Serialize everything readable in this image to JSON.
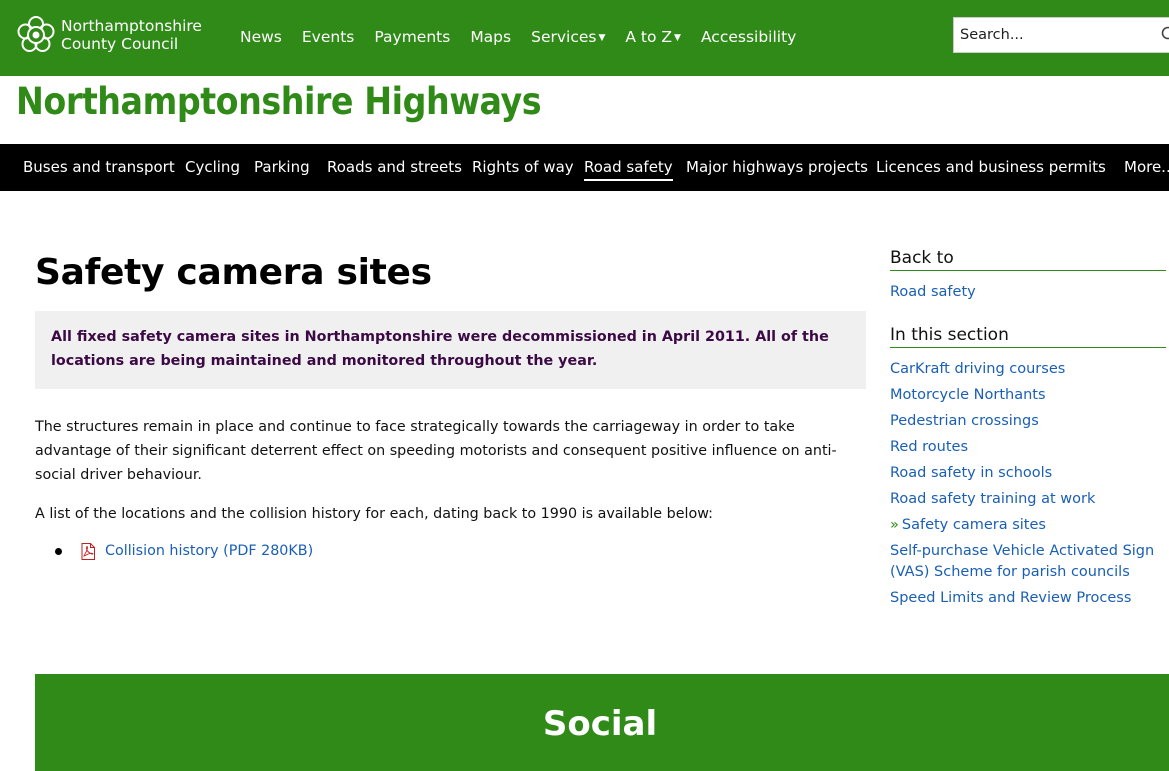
{
  "header": {
    "logo_line1": "Northamptonshire",
    "logo_line2": "County Council",
    "nav": [
      {
        "label": "News"
      },
      {
        "label": "Events"
      },
      {
        "label": "Payments"
      },
      {
        "label": "Maps"
      },
      {
        "label": "Services",
        "dropdown": true
      },
      {
        "label": "A to Z",
        "dropdown": true
      },
      {
        "label": "Accessibility"
      }
    ],
    "search_placeholder": "Search..."
  },
  "site_title": "Northamptonshire Highways",
  "main_nav": [
    {
      "label": "Buses and transport"
    },
    {
      "label": "Cycling"
    },
    {
      "label": "Parking"
    },
    {
      "label": "Roads and streets"
    },
    {
      "label": "Rights of way"
    },
    {
      "label": "Road safety",
      "active": true
    },
    {
      "label": "Major highways projects"
    },
    {
      "label": "Licences and business permits"
    },
    {
      "label": "More.."
    }
  ],
  "content": {
    "title": "Safety camera sites",
    "callout": "All fixed safety camera sites in Northamptonshire were decommissioned in April 2011.  All of the locations are being maintained and monitored throughout the year.",
    "paragraph1": "The structures remain in place and continue to face strategically towards the carriageway in order to take advantage of their significant deterrent effect on speeding motorists and consequent positive influence on anti-social driver behaviour.",
    "paragraph2": "A list of the locations and the collision history for each, dating back to 1990 is available below:",
    "documents": [
      {
        "label": "Collision history (PDF 280KB)",
        "icon": "pdf-icon"
      }
    ]
  },
  "sidebar": {
    "back_heading": "Back to",
    "back_link": "Road safety",
    "section_heading": "In this section",
    "items": [
      {
        "label": "CarKraft driving courses"
      },
      {
        "label": "Motorcycle Northants"
      },
      {
        "label": "Pedestrian crossings"
      },
      {
        "label": "Red routes"
      },
      {
        "label": "Road safety in schools"
      },
      {
        "label": "Road safety training at work"
      },
      {
        "label": "Safety camera sites",
        "current": true
      },
      {
        "label": "Self-purchase Vehicle Activated Sign (VAS) Scheme for parish councils"
      },
      {
        "label": "Speed Limits and Review Process"
      }
    ]
  },
  "footer": {
    "social_title": "Social"
  },
  "colors": {
    "brand_green": "#2f8a17",
    "nav_black": "#000000",
    "link_blue": "#1a5fb4",
    "callout_text": "#3b0a45"
  }
}
